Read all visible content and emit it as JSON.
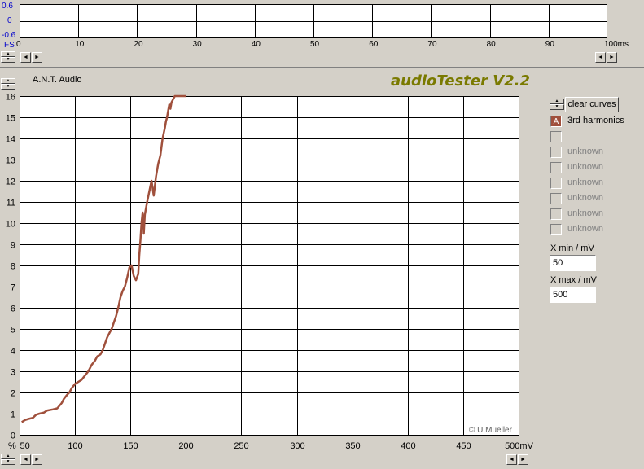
{
  "top_scope": {
    "y_ticks": [
      "0.6",
      "0",
      "-0.6"
    ],
    "fs_label": "FS",
    "x_ticks": [
      "0",
      "10",
      "20",
      "30",
      "40",
      "50",
      "60",
      "70",
      "80",
      "90",
      "100ms"
    ]
  },
  "brand": "A.N.T. Audio",
  "app_title": "audioTester V2.2",
  "copyright": "© U.Mueller",
  "controls": {
    "clear_label": "clear curves",
    "channels": [
      {
        "marker": "A",
        "label": "3rd harmonics",
        "color": "#a0503c",
        "active": true
      },
      {
        "marker": "",
        "label": "",
        "active": false
      },
      {
        "marker": "",
        "label": "unknown",
        "active": false
      },
      {
        "marker": "",
        "label": "unknown",
        "active": false
      },
      {
        "marker": "",
        "label": "unknown",
        "active": false
      },
      {
        "marker": "",
        "label": "unknown",
        "active": false
      },
      {
        "marker": "",
        "label": "unknown",
        "active": false
      },
      {
        "marker": "",
        "label": "unknown",
        "active": false
      }
    ],
    "xmin_label": "X min / mV",
    "xmin_value": "50",
    "xmax_label": "X max / mV",
    "xmax_value": "500"
  },
  "chart_data": {
    "type": "line",
    "xlabel": "",
    "ylabel": "",
    "y_unit_label": "%",
    "xlim": [
      50,
      500
    ],
    "ylim": [
      0,
      16
    ],
    "x_tick_labels": [
      "50",
      "100",
      "150",
      "200",
      "250",
      "300",
      "350",
      "400",
      "450",
      "500mV"
    ],
    "y_tick_labels": [
      "0",
      "1",
      "2",
      "3",
      "4",
      "5",
      "6",
      "7",
      "8",
      "9",
      "10",
      "11",
      "12",
      "13",
      "14",
      "15",
      "16"
    ],
    "grid": true,
    "series": [
      {
        "name": "3rd harmonics",
        "color": "#a0503c",
        "x": [
          52,
          55,
          58,
          62,
          65,
          68,
          72,
          75,
          80,
          84,
          88,
          90,
          93,
          95,
          97,
          100,
          103,
          106,
          109,
          112,
          115,
          118,
          120,
          123,
          125,
          127,
          129,
          131,
          133,
          135,
          137,
          139,
          141,
          143,
          145,
          147,
          149,
          151,
          153,
          155,
          157,
          158,
          159,
          160,
          161,
          162,
          163,
          165,
          167,
          169,
          171,
          173,
          175,
          177,
          179,
          181,
          182,
          183,
          184,
          185,
          186,
          187,
          188,
          189,
          190,
          191,
          192,
          200
        ],
        "y": [
          0.6,
          0.7,
          0.75,
          0.8,
          0.95,
          1.0,
          1.05,
          1.15,
          1.2,
          1.25,
          1.5,
          1.7,
          1.9,
          2.0,
          2.2,
          2.4,
          2.5,
          2.6,
          2.8,
          3.0,
          3.3,
          3.5,
          3.7,
          3.8,
          4.0,
          4.3,
          4.6,
          4.8,
          5.0,
          5.3,
          5.6,
          6.0,
          6.5,
          6.8,
          7.0,
          7.4,
          7.9,
          8.0,
          7.5,
          7.3,
          7.6,
          8.5,
          9.2,
          10.0,
          10.5,
          9.5,
          10.4,
          11.0,
          11.5,
          12.0,
          11.3,
          12.2,
          12.8,
          13.2,
          14.0,
          14.5,
          14.8,
          15.0,
          15.3,
          15.6,
          15.4,
          15.7,
          15.8,
          15.9,
          16.0,
          16.0,
          16.0,
          16.0
        ]
      }
    ]
  }
}
